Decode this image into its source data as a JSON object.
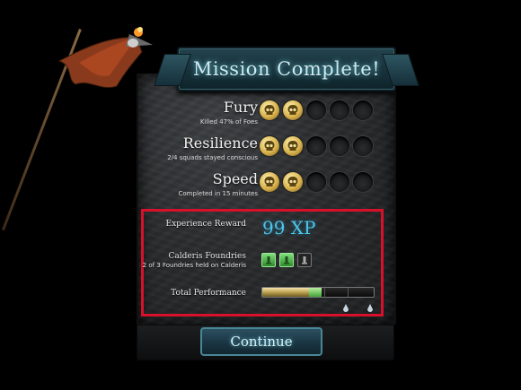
{
  "title": "Mission Complete!",
  "stats": [
    {
      "name": "Fury",
      "detail": "Killed 47% of Foes",
      "medals_earned": 2,
      "medals_total": 5
    },
    {
      "name": "Resilience",
      "detail": "2/4 squads stayed conscious",
      "medals_earned": 2,
      "medals_total": 5
    },
    {
      "name": "Speed",
      "detail": "Completed in 15 minutes",
      "medals_earned": 2,
      "medals_total": 5
    }
  ],
  "rewards": {
    "experience_label": "Experience Reward",
    "experience_value": "99 XP",
    "foundries_label": "Calderis Foundries",
    "foundries_detail": "2 of 3 Foundries held on Calderis",
    "foundries_held": 2,
    "foundries_total": 3,
    "performance_label": "Total Performance",
    "performance_previous": 0.42,
    "performance_gain": 0.11
  },
  "continue_label": "Continue",
  "colors": {
    "accent": "#4fc3e8",
    "highlight_border": "#d8102a",
    "medal_gold": "#d9b14c",
    "foundry_green": "#43a337"
  }
}
